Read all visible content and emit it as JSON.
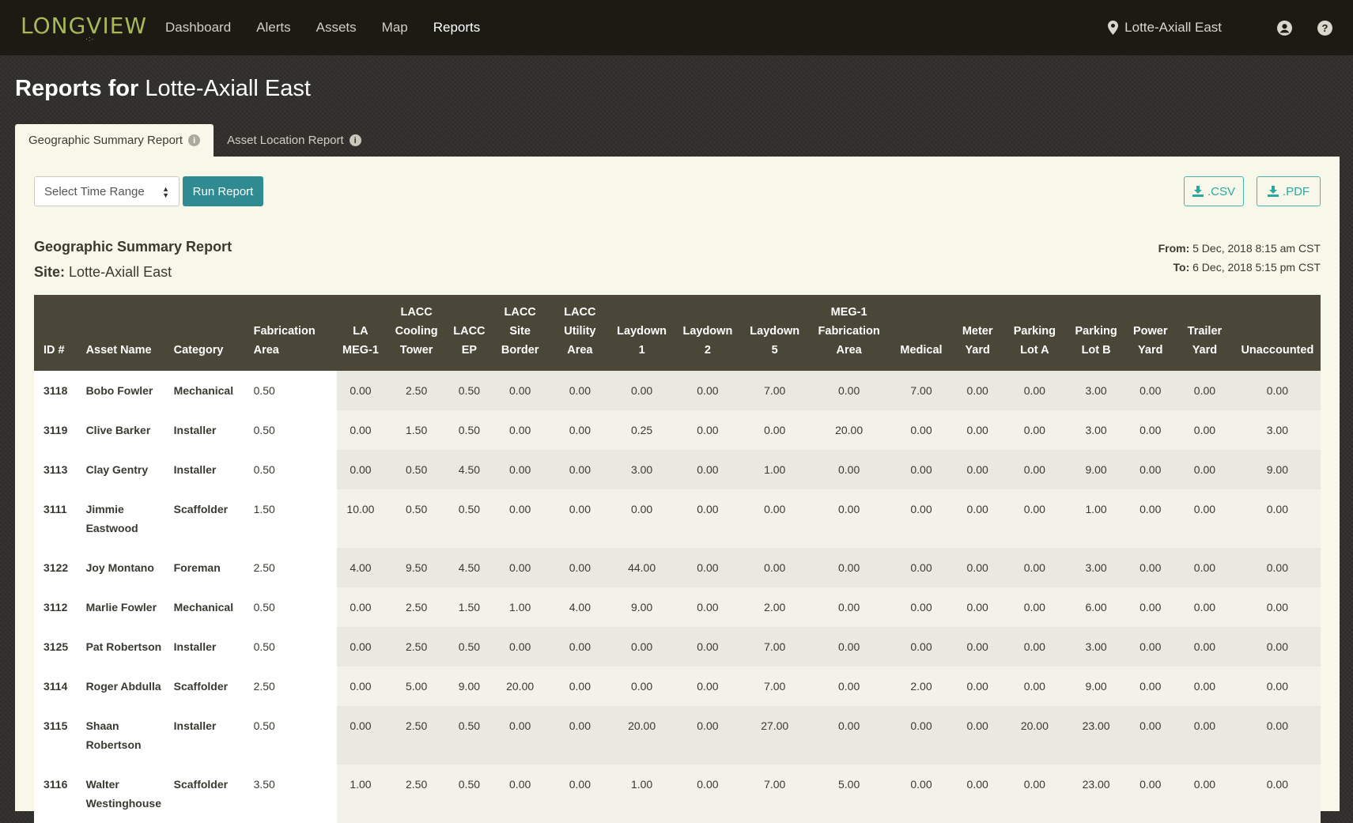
{
  "app": {
    "logo": "LONGVIEW",
    "logo_dots": "·:·",
    "nav": [
      "Dashboard",
      "Alerts",
      "Assets",
      "Map",
      "Reports"
    ],
    "active_nav": "Reports",
    "site": "Lotte-Axiall East"
  },
  "page": {
    "title_prefix": "Reports for",
    "title_site": "Lotte-Axiall East"
  },
  "tabs": [
    {
      "label": "Geographic Summary Report",
      "active": true
    },
    {
      "label": "Asset Location Report",
      "active": false
    }
  ],
  "controls": {
    "time_range_placeholder": "Select Time Range",
    "run_label": "Run Report",
    "csv_label": ".CSV",
    "pdf_label": ".PDF"
  },
  "report": {
    "title": "Geographic Summary Report",
    "site_label": "Site:",
    "site": "Lotte-Axiall East",
    "from_label": "From:",
    "from": "5 Dec, 2018 8:15 am CST",
    "to_label": "To:",
    "to": "6 Dec, 2018 5:15 pm CST"
  },
  "table": {
    "columns": [
      "ID #",
      "Asset Name",
      "Category",
      "Fabrication Area",
      "LA MEG-1",
      "LACC Cooling Tower",
      "LACC EP",
      "LACC Site Border",
      "LACC Utility Area",
      "Laydown 1",
      "Laydown 2",
      "Laydown 5",
      "MEG-1 Fabrication Area",
      "Medical",
      "Meter Yard",
      "Parking Lot A",
      "Parking Lot B",
      "Power Yard",
      "Trailer Yard",
      "Unaccounted"
    ],
    "rows": [
      [
        "3118",
        "Bobo Fowler",
        "Mechanical",
        "0.50",
        "0.00",
        "2.50",
        "0.50",
        "0.00",
        "0.00",
        "0.00",
        "0.00",
        "7.00",
        "0.00",
        "7.00",
        "0.00",
        "0.00",
        "3.00",
        "0.00",
        "0.00",
        "0.00"
      ],
      [
        "3119",
        "Clive Barker",
        "Installer",
        "0.50",
        "0.00",
        "1.50",
        "0.50",
        "0.00",
        "0.00",
        "0.25",
        "0.00",
        "0.00",
        "20.00",
        "0.00",
        "0.00",
        "0.00",
        "3.00",
        "0.00",
        "0.00",
        "3.00"
      ],
      [
        "3113",
        "Clay Gentry",
        "Installer",
        "0.50",
        "0.00",
        "0.50",
        "4.50",
        "0.00",
        "0.00",
        "3.00",
        "0.00",
        "1.00",
        "0.00",
        "0.00",
        "0.00",
        "0.00",
        "9.00",
        "0.00",
        "0.00",
        "9.00"
      ],
      [
        "3111",
        "Jimmie Eastwood",
        "Scaffolder",
        "1.50",
        "10.00",
        "0.50",
        "0.50",
        "0.00",
        "0.00",
        "0.00",
        "0.00",
        "0.00",
        "0.00",
        "0.00",
        "0.00",
        "0.00",
        "1.00",
        "0.00",
        "0.00",
        "0.00"
      ],
      [
        "3122",
        "Joy Montano",
        "Foreman",
        "2.50",
        "4.00",
        "9.50",
        "4.50",
        "0.00",
        "0.00",
        "44.00",
        "0.00",
        "0.00",
        "0.00",
        "0.00",
        "0.00",
        "0.00",
        "3.00",
        "0.00",
        "0.00",
        "0.00"
      ],
      [
        "3112",
        "Marlie Fowler",
        "Mechanical",
        "0.50",
        "0.00",
        "2.50",
        "1.50",
        "1.00",
        "4.00",
        "9.00",
        "0.00",
        "2.00",
        "0.00",
        "0.00",
        "0.00",
        "0.00",
        "6.00",
        "0.00",
        "0.00",
        "0.00"
      ],
      [
        "3125",
        "Pat Robertson",
        "Installer",
        "0.50",
        "0.00",
        "2.50",
        "0.50",
        "0.00",
        "0.00",
        "0.00",
        "0.00",
        "7.00",
        "0.00",
        "0.00",
        "0.00",
        "0.00",
        "3.00",
        "0.00",
        "0.00",
        "0.00"
      ],
      [
        "3114",
        "Roger Abdulla",
        "Scaffolder",
        "2.50",
        "0.00",
        "5.00",
        "9.00",
        "20.00",
        "0.00",
        "0.00",
        "0.00",
        "7.00",
        "0.00",
        "2.00",
        "0.00",
        "0.00",
        "9.00",
        "0.00",
        "0.00",
        "0.00"
      ],
      [
        "3115",
        "Shaan Robertson",
        "Installer",
        "0.50",
        "0.00",
        "2.50",
        "0.50",
        "0.00",
        "0.00",
        "20.00",
        "0.00",
        "27.00",
        "0.00",
        "0.00",
        "0.00",
        "20.00",
        "23.00",
        "0.00",
        "0.00",
        "0.00"
      ],
      [
        "3116",
        "Walter Westinghouse",
        "Scaffolder",
        "3.50",
        "1.00",
        "2.50",
        "0.50",
        "0.00",
        "0.00",
        "1.00",
        "0.00",
        "7.00",
        "5.00",
        "0.00",
        "0.00",
        "0.00",
        "23.00",
        "0.00",
        "0.00",
        "0.00"
      ]
    ]
  },
  "colors": {
    "topbar": "#1c1b13",
    "logo": "#a9b85a",
    "accent": "#2d8b91",
    "download": "#2aa89d",
    "table_header": "#4a4738",
    "panel": "#f8f8ea"
  },
  "icons": {
    "site": "map-pin-icon",
    "account": "user-circle-icon",
    "help": "help-circle-icon",
    "tab_info": "info-icon",
    "download": "download-icon"
  }
}
